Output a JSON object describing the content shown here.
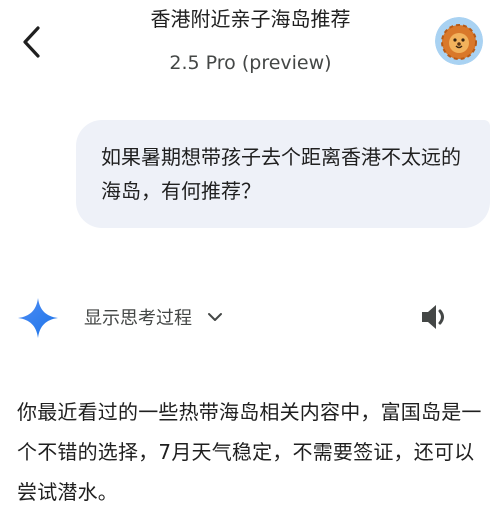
{
  "header": {
    "title": "香港附近亲子海岛推荐",
    "model": "2.5 Pro (preview)"
  },
  "conversation": {
    "user_message": "如果暑期想带孩子去个距离香港不太远的海岛，有何推荐？",
    "show_thinking_label": "显示思考过程",
    "answer": "你最近看过的一些热带海岛相关内容中，富国岛是一个不错的选择，7月天气稳定，不需要签证，还可以尝试潜水。"
  },
  "icons": {
    "back": "back-arrow-icon",
    "avatar": "lion-avatar-icon",
    "assistant": "gemini-sparkle-icon",
    "expand": "chevron-down-icon",
    "speaker": "speaker-icon"
  },
  "colors": {
    "bubble": "#eef1f8",
    "sparkle_start": "#4f8df5",
    "sparkle_end": "#1a73e8",
    "avatar_bg": "#a9d2f2",
    "lion": "#d9782a"
  }
}
